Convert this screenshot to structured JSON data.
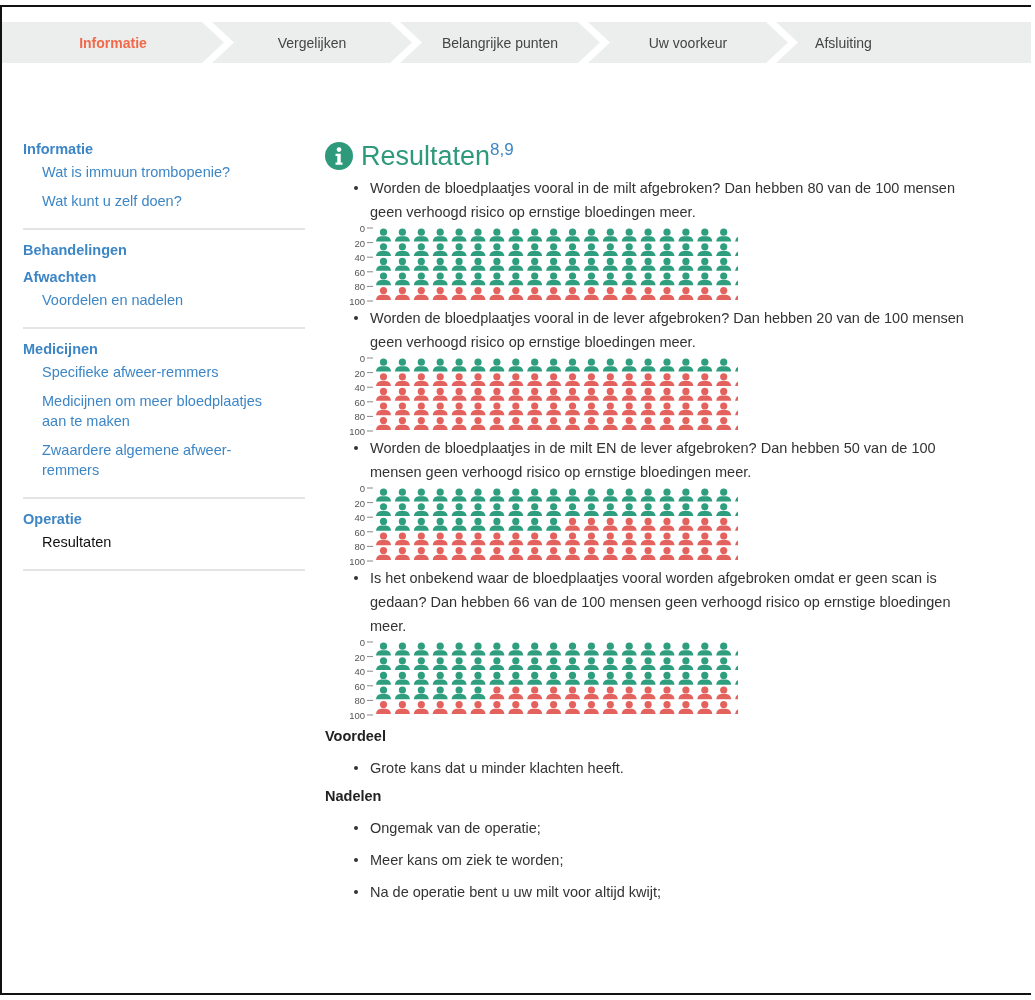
{
  "steps": [
    {
      "label": "Informatie",
      "selected": true
    },
    {
      "label": "Vergelijken",
      "selected": false
    },
    {
      "label": "Belangrijke punten",
      "selected": false
    },
    {
      "label": "Uw voorkeur",
      "selected": false
    },
    {
      "label": "Afsluiting",
      "selected": false
    }
  ],
  "sidebar": {
    "groups": [
      {
        "label": "Informatie",
        "children": [
          {
            "label": "Wat is immuun trombopenie?",
            "selected": false
          },
          {
            "label": "Wat kunt u zelf doen?",
            "selected": false
          }
        ]
      },
      {
        "label": "Behandelingen"
      },
      {
        "label": "Afwachten",
        "children": [
          {
            "label": "Voordelen en nadelen",
            "selected": false
          }
        ]
      },
      {
        "label": "Medicijnen",
        "children": [
          {
            "label": "Specifieke afweer-remmers",
            "selected": false
          },
          {
            "label": "Medicijnen om meer bloedplaatjes aan te maken",
            "selected": false
          },
          {
            "label": "Zwaardere algemene afweer-remmers",
            "selected": false
          }
        ]
      },
      {
        "label": "Operatie",
        "children": [
          {
            "label": "Resultaten",
            "selected": true
          }
        ]
      }
    ]
  },
  "content": {
    "title": "Resultaten$^{8,9}$",
    "results": [
      {
        "text": "Worden de bloedplaatjes vooral in de milt afgebroken? Dan hebben 80 van de 100 mensen geen verhoogd risico op ernstige bloedingen meer.",
        "ticks": [
          "0",
          "20",
          "40",
          "60",
          "80",
          "100"
        ]
      },
      {
        "text": "Worden de bloedplaatjes vooral in de lever afgebroken? Dan hebben 20 van de 100 mensen geen verhoogd risico op ernstige bloedingen meer.",
        "ticks": [
          "0",
          "20",
          "40",
          "60",
          "80",
          "100"
        ]
      },
      {
        "text": "Worden de bloedplaatjes in de milt EN de lever afgebroken? Dan hebben 50 van de 100 mensen geen verhoogd risico op ernstige bloedingen meer.",
        "ticks": [
          "0",
          "20",
          "40",
          "60",
          "80",
          "100"
        ]
      },
      {
        "text": "Is het onbekend waar de bloedplaatjes vooral worden afgebroken omdat er geen scan is gedaan? Dan hebben 66 van de 100 mensen geen verhoogd risico op ernstige bloedingen meer.",
        "ticks": [
          "0",
          "20",
          "40",
          "60",
          "80",
          "100"
        ]
      }
    ],
    "sections": [
      {
        "heading": "Voordeel",
        "items": [
          "Grote kans dat u minder klachten heeft."
        ]
      },
      {
        "heading": "Nadelen",
        "items": [
          "Ongemak van de operatie;",
          "Meer kans om ziek te worden;",
          "Na de operatie bent u uw milt voor altijd kwijt;"
        ]
      }
    ]
  }
}
